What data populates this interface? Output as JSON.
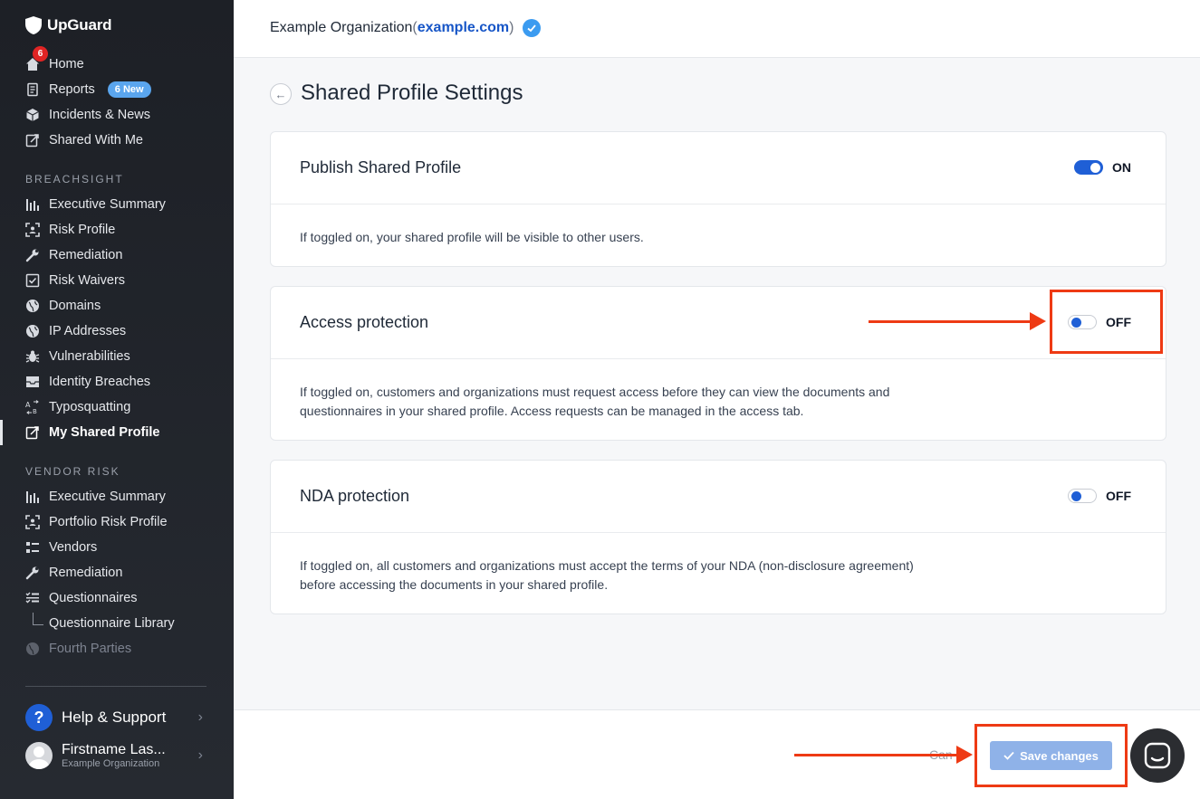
{
  "app": {
    "name": "UpGuard"
  },
  "sidebar": {
    "home_badge": "6",
    "top_items": [
      {
        "label": "Home",
        "icon": "home-icon"
      },
      {
        "label": "Reports",
        "icon": "document-icon",
        "pill": "6 New"
      },
      {
        "label": "Incidents & News",
        "icon": "cube-icon"
      },
      {
        "label": "Shared With Me",
        "icon": "share-icon"
      }
    ],
    "breachsight_label": "BREACHSIGHT",
    "breachsight_items": [
      {
        "label": "Executive Summary",
        "icon": "bar-chart-icon"
      },
      {
        "label": "Risk Profile",
        "icon": "risk-profile-icon"
      },
      {
        "label": "Remediation",
        "icon": "wrench-icon"
      },
      {
        "label": "Risk Waivers",
        "icon": "checkbox-icon"
      },
      {
        "label": "Domains",
        "icon": "globe-icon"
      },
      {
        "label": "IP Addresses",
        "icon": "globe-icon"
      },
      {
        "label": "Vulnerabilities",
        "icon": "bug-icon"
      },
      {
        "label": "Identity Breaches",
        "icon": "inbox-icon"
      },
      {
        "label": "Typosquatting",
        "icon": "typosquat-icon"
      },
      {
        "label": "My Shared Profile",
        "icon": "share-icon",
        "active": true
      }
    ],
    "vendor_label": "VENDOR RISK",
    "vendor_items": [
      {
        "label": "Executive Summary",
        "icon": "bar-chart-icon"
      },
      {
        "label": "Portfolio Risk Profile",
        "icon": "risk-profile-icon"
      },
      {
        "label": "Vendors",
        "icon": "list-icon"
      },
      {
        "label": "Remediation",
        "icon": "wrench-icon"
      },
      {
        "label": "Questionnaires",
        "icon": "checklist-icon"
      },
      {
        "label": "Questionnaire Library",
        "icon": ""
      },
      {
        "label": "Fourth Parties",
        "icon": "globe-icon",
        "disabled": true
      }
    ],
    "help_label": "Help & Support",
    "help_icon_text": "?",
    "user_name": "Firstname Las...",
    "user_org": "Example Organization"
  },
  "header": {
    "org_name": "Example Organization",
    "open_paren": "(",
    "domain": "example.com",
    "close_paren": ")"
  },
  "page": {
    "title": "Shared Profile Settings",
    "back_icon": "←"
  },
  "cards": [
    {
      "title": "Publish Shared Profile",
      "state": "ON",
      "on": true,
      "description": "If toggled on, your shared profile will be visible to other users."
    },
    {
      "title": "Access protection",
      "state": "OFF",
      "on": false,
      "description": "If toggled on, customers and organizations must request access before they can view the documents and questionnaires in your shared profile. Access requests can be managed in the access tab."
    },
    {
      "title": "NDA protection",
      "state": "OFF",
      "on": false,
      "description": "If toggled on, all customers and organizations must accept the terms of your NDA (non-disclosure agreement) before accessing the documents in your shared profile."
    }
  ],
  "footer": {
    "cancel_label": "Can",
    "save_label": "Save changes"
  },
  "colors": {
    "accent": "#1f5fd6",
    "annotation": "#ee3a14",
    "save_disabled": "#8fb2e8"
  }
}
